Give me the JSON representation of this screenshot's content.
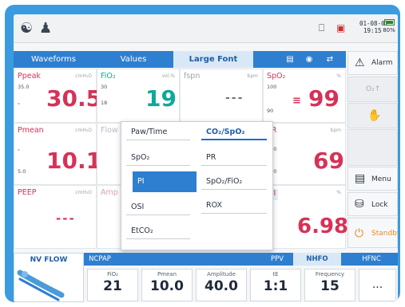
{
  "status_bar": {
    "date": "01-08-07",
    "time": "19:15",
    "battery": "80%",
    "icons": [
      "patient-adult-icon",
      "patient-infant-icon",
      "clipboard-icon",
      "monitor-alert-icon"
    ]
  },
  "tabs": [
    {
      "label": "Waveforms",
      "active": false
    },
    {
      "label": "Values",
      "active": false
    },
    {
      "label": "Large Font",
      "active": true
    }
  ],
  "tab_icons": [
    "document-icon",
    "camera-icon",
    "screen-switch-icon"
  ],
  "tiles": {
    "ppeak": {
      "label": "Ppeak",
      "unit": "cmH₂O",
      "high": "35.0",
      "low": "ₓ",
      "value": "30.5"
    },
    "fio2": {
      "label": "FiO₂",
      "unit": "vol.%",
      "high": "30",
      "low": "18",
      "value": "19"
    },
    "fspn": {
      "label": "fspn",
      "unit": "bpm",
      "value": "---"
    },
    "spo2": {
      "label": "SpO₂",
      "unit": "%",
      "high": "100",
      "low": "90",
      "value": "99"
    },
    "pmean": {
      "label": "Pmean",
      "unit": "cmH₂O",
      "high": "ₓ",
      "low": "5.0",
      "value": "10.1"
    },
    "flow": {
      "label": "Flow"
    },
    "pr": {
      "label": "PR",
      "unit": "bpm",
      "high": "200",
      "low": "100",
      "value": "69"
    },
    "peep": {
      "label": "PEEP",
      "unit": "cmH₂O",
      "value": "---"
    },
    "amp": {
      "label": "Amp"
    },
    "pi": {
      "label": "PI",
      "unit": "%",
      "value": "6.98"
    }
  },
  "side_buttons": [
    {
      "label": "Alarm",
      "icon": "alarm-icon"
    },
    {
      "label": "O₂↑",
      "icon": ""
    },
    {
      "label": "",
      "icon": "hand-icon"
    },
    {
      "label": "Menu",
      "icon": "menu-icon"
    },
    {
      "label": "Lock",
      "icon": "lock-icon"
    },
    {
      "label": "Standby",
      "icon": "power-icon"
    }
  ],
  "popup": {
    "options": [
      {
        "label": "Paw/Time"
      },
      {
        "label": "CO₂/SpO₂"
      },
      {
        "label": "SpO₂"
      },
      {
        "label": "PR"
      },
      {
        "label": "PI"
      },
      {
        "label": "SpO₂/FiO₂"
      },
      {
        "label": "OSI"
      },
      {
        "label": "ROX"
      },
      {
        "label": "EtCO₂"
      }
    ]
  },
  "mode_bar": {
    "nv_title": "NV FLOW",
    "tabs": [
      {
        "label": "NCPAP",
        "active": false
      },
      {
        "label": "PPV",
        "active": false
      },
      {
        "label": "NHFO",
        "active": true
      },
      {
        "label": "HFNC",
        "active": false
      }
    ],
    "settings": [
      {
        "label": "FiO₂",
        "value": "21"
      },
      {
        "label": "Pmean",
        "value": "10.0"
      },
      {
        "label": "Amplitude",
        "value": "40.0"
      },
      {
        "label": "tE",
        "value": "1:1"
      },
      {
        "label": "Frequency",
        "value": "15"
      }
    ],
    "more": "..."
  },
  "colors": {
    "accent": "#2e7fd0",
    "frame": "#3a9be0",
    "alarm_red": "#d63257",
    "teal": "#11a89b"
  }
}
